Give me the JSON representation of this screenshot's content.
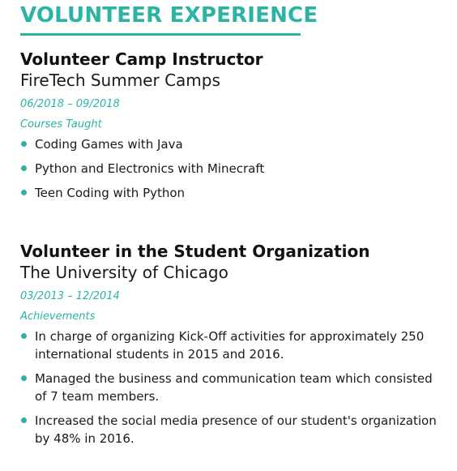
{
  "section": {
    "title": "VOLUNTEER EXPERIENCE",
    "accent_color": "#2bb3a3"
  },
  "entries": [
    {
      "role": "Volunteer Camp Instructor",
      "organization": "FireTech Summer Camps",
      "dates": "06/2018 – 09/2018",
      "subheading": "Courses Taught",
      "bullets": [
        "Coding Games with Java",
        "Python and Electronics with Minecraft",
        "Teen Coding with Python"
      ]
    },
    {
      "role": "Volunteer in the Student Organization",
      "organization": "The University of Chicago",
      "dates": "03/2013 – 12/2014",
      "subheading": "Achievements",
      "bullets": [
        "In charge of organizing Kick-Off activities for approximately 250 international students in 2015 and 2016.",
        "Managed the business and communication team which consisted of 7 team members.",
        "Increased the social media presence of our student's organization by 48% in 2016."
      ]
    }
  ]
}
